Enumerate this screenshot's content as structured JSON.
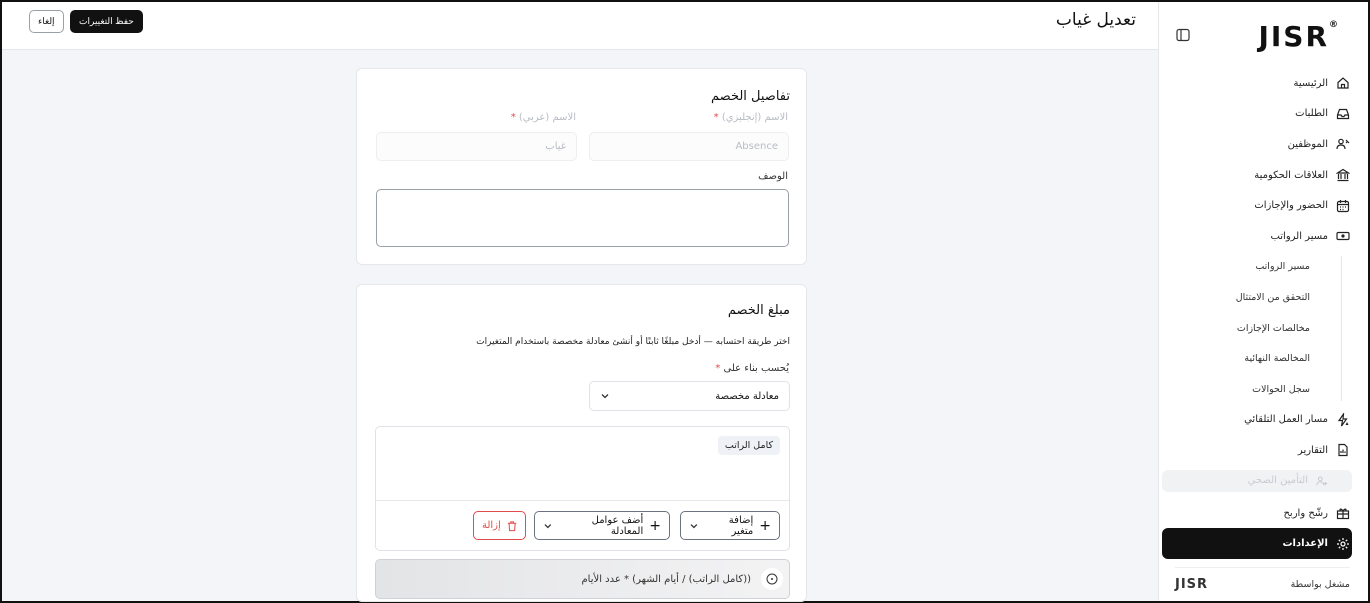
{
  "header": {
    "title": "تعديل غياب",
    "save_label": "حفظ التغييرات",
    "cancel_label": "إلغاء"
  },
  "sidebar": {
    "logo": "JISR",
    "items": [
      {
        "label": "الرئيسية",
        "icon": "home-icon"
      },
      {
        "label": "الطلبات",
        "icon": "inbox-icon"
      },
      {
        "label": "الموظفين",
        "icon": "users-icon"
      },
      {
        "label": "العلاقات الحكومية",
        "icon": "bank-icon"
      },
      {
        "label": "الحضور والإجازات",
        "icon": "calendar-icon"
      },
      {
        "label": "مسير الرواتب",
        "icon": "money-icon"
      }
    ],
    "payroll_sub": [
      "مسير الرواتب",
      "التحقق من الامتثال",
      "مخالصات الإجازات",
      "المخالصة النهائية",
      "سجل الحوالات"
    ],
    "items2": [
      {
        "label": "مسار العمل التلقائي",
        "icon": "automation-icon"
      },
      {
        "label": "التقارير",
        "icon": "report-icon"
      }
    ],
    "disabled_item": "التأمين الصحي",
    "items3": [
      {
        "label": "رشّح واربح",
        "icon": "gift-icon"
      }
    ],
    "active_item": {
      "label": "الإعدادات",
      "icon": "gear-icon"
    },
    "footer_label": "مشغل بواسطة",
    "footer_logo": "JISR"
  },
  "details_card": {
    "title": "تفاصيل الخصم",
    "name_en_label": "الاسم (إنجليزي)",
    "name_ar_label": "الاسم (عربي)",
    "required_mark": "*",
    "name_en_value": "Absence",
    "name_ar_value": "غياب",
    "description_label": "الوصف"
  },
  "amount_card": {
    "title": "مبلغ الخصم",
    "hint": "اختر طريقة احتسابه — أدخل مبلغًا ثابتًا أو أنشئ معادلة مخصصة باستخدام المتغيرات",
    "calc_label": "يُحسب بناء على",
    "calc_value": "معادلة مخصصة",
    "token": "كامل الراتب",
    "add_variable": "إضافة متغير",
    "add_operators": "أضف عوامل المعادلة",
    "remove": "إزالة",
    "preview": "((كامل الراتب) / أيام الشهر) * عدد الأيام"
  },
  "colors": {
    "primary": "#111111",
    "danger": "#e04b4b",
    "background": "#f4f5f9"
  }
}
